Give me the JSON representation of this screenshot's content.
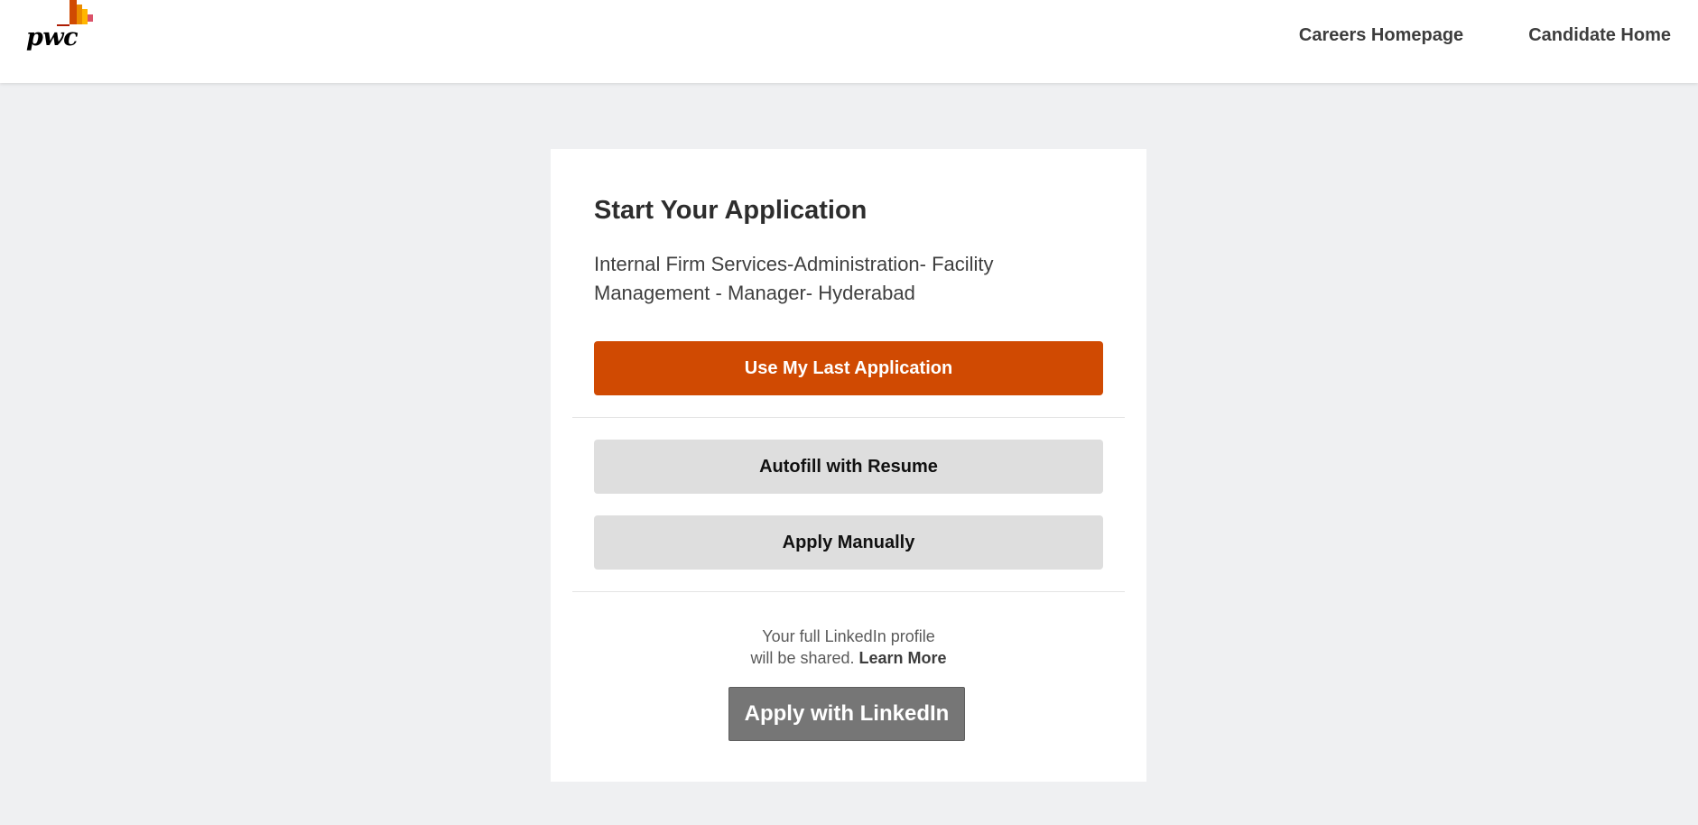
{
  "brand": {
    "logo_text": "pwc",
    "colors": {
      "accent": "#d04a02",
      "logo_dark_red": "#ad1b02",
      "logo_orange": "#d04a02",
      "logo_amber": "#eb8c00",
      "logo_yellow": "#ffb600",
      "logo_rose": "#db536a"
    }
  },
  "header": {
    "nav": [
      {
        "label": "Careers Homepage"
      },
      {
        "label": "Candidate Home"
      }
    ]
  },
  "card": {
    "title": "Start Your Application",
    "job_title": "Internal Firm Services-Administration- Facility Management - Manager- Hyderabad",
    "buttons": {
      "use_last": "Use My Last Application",
      "autofill": "Autofill with Resume",
      "manual": "Apply Manually"
    },
    "linkedin": {
      "note_line1": "Your full LinkedIn profile",
      "note_line2": "will be shared.",
      "learn_more": "Learn More",
      "button": "Apply with LinkedIn"
    }
  }
}
